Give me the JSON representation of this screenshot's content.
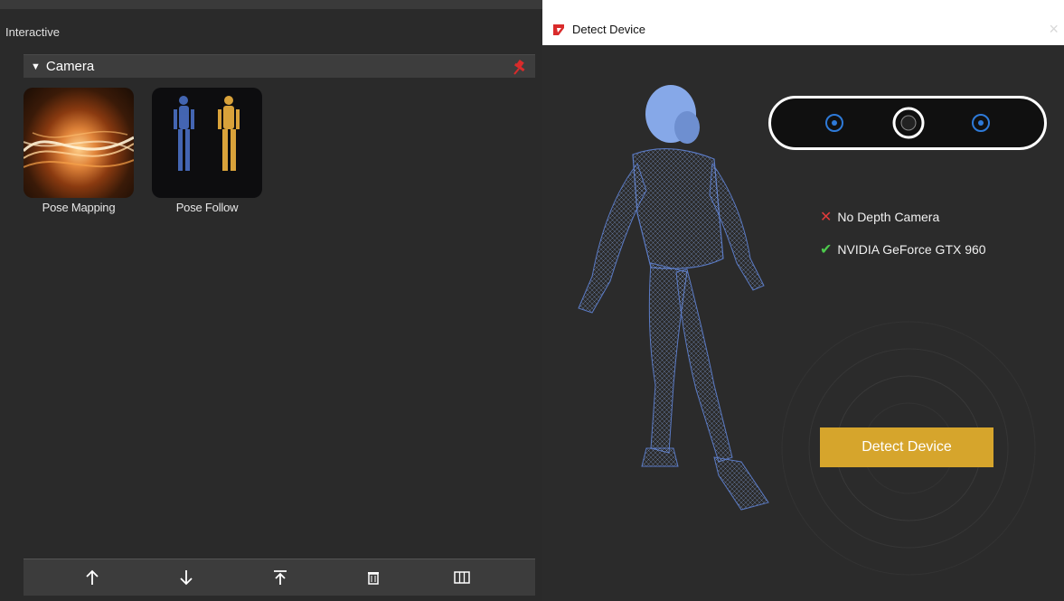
{
  "left_panel": {
    "title": "Interactive",
    "category": {
      "label": "Camera",
      "expanded": true,
      "pin_icon": "pin-icon"
    },
    "tiles": [
      {
        "label": "Pose Mapping",
        "icon": "silk-light-thumbnail"
      },
      {
        "label": "Pose Follow",
        "icon": "two-figures-thumbnail"
      }
    ],
    "toolbar": [
      {
        "icon": "arrow-up-icon",
        "glyph": "↑"
      },
      {
        "icon": "arrow-down-icon",
        "glyph": "↓"
      },
      {
        "icon": "move-to-top-icon",
        "glyph": "⤒"
      },
      {
        "icon": "trash-icon",
        "glyph": ""
      },
      {
        "icon": "columns-icon",
        "glyph": ""
      }
    ]
  },
  "dialog": {
    "title": "Detect Device",
    "close_glyph": "×",
    "status": [
      {
        "mark": "✕",
        "text": "No Depth Camera",
        "ok": false,
        "color": "#e03b3b"
      },
      {
        "mark": "✔",
        "text": "NVIDIA GeForce GTX 960",
        "ok": true,
        "color": "#4cc94c"
      }
    ],
    "button_label": "Detect Device"
  },
  "colors": {
    "accent": "#d6a52c",
    "panel_bg": "#2a2a2a",
    "dialog_bg": "#2b2b2b",
    "wireframe": "#6f8fd8",
    "brand_red": "#d92b2b"
  }
}
